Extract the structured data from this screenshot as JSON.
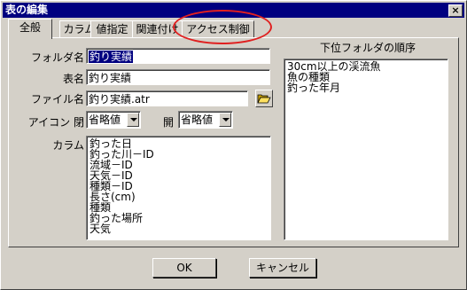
{
  "window": {
    "title": "表の編集",
    "close_glyph": "×"
  },
  "tabs": [
    {
      "label": "全般",
      "active": true
    },
    {
      "label": "カラム"
    },
    {
      "label": "値指定"
    },
    {
      "label": "関連付け"
    },
    {
      "label": "アクセス制御"
    }
  ],
  "form": {
    "folder_label": "フォルダ名",
    "folder_value": "釣り実績",
    "table_label": "表名",
    "table_value": "釣り実績",
    "file_label": "ファイル名",
    "file_value": "釣り実績.atr",
    "icon_label": "アイコン 閉",
    "icon_closed_value": "省略値",
    "icon_open_label": "開",
    "icon_open_value": "省略値",
    "columns_label": "カラム",
    "columns": [
      "釣った日",
      "釣った川－ID",
      "流域－ID",
      "天気－ID",
      "種類－ID",
      "長さ(cm)",
      "種類",
      "釣った場所",
      "天気"
    ]
  },
  "subfolder": {
    "label": "下位フォルダの順序",
    "items": [
      "30cm以上の渓流魚",
      "魚の種類",
      "釣った年月"
    ]
  },
  "buttons": {
    "ok": "OK",
    "cancel": "キャンセル"
  },
  "colors": {
    "titlebar": "#000080",
    "face": "#d4d0c8",
    "annotation": "#e02020"
  },
  "icons": {
    "folder_browse": "folder-open-icon"
  }
}
